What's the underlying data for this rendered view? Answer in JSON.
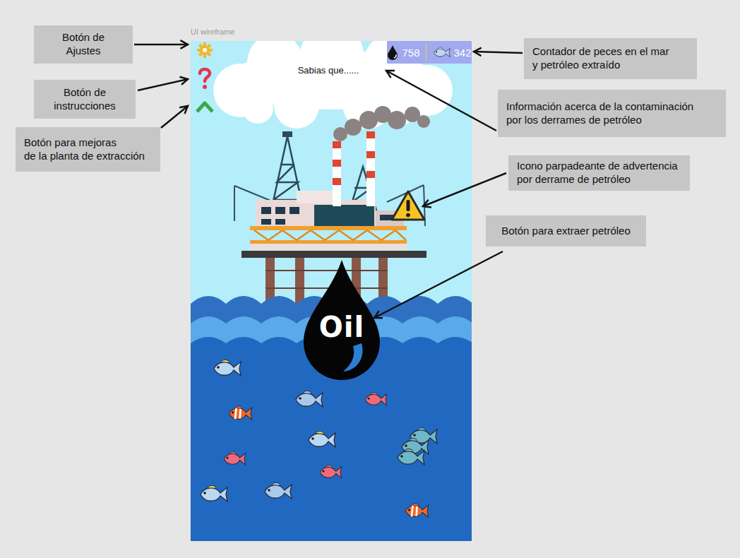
{
  "canvas_label": "UI wireframe",
  "annotations": [
    {
      "lines": [
        "Botón de",
        "Ajustes"
      ]
    },
    {
      "lines": [
        "Botón de",
        "instrucciones"
      ]
    },
    {
      "lines": [
        "Botón para mejoras",
        "de la planta de extracción"
      ]
    },
    {
      "lines": [
        "Contador de peces en el mar",
        "y petróleo extraído"
      ]
    },
    {
      "lines": [
        "Información acerca de la contaminación",
        "por los derrames de petróleo"
      ]
    },
    {
      "lines": [
        "Icono parpadeante de advertencia",
        "por derrame de petróleo"
      ]
    },
    {
      "lines": [
        "Botón para extraer petróleo"
      ]
    }
  ],
  "game": {
    "fact": "Sabias que......",
    "oil_count": "758",
    "fish_count": "342",
    "oil_button": "Oil"
  }
}
